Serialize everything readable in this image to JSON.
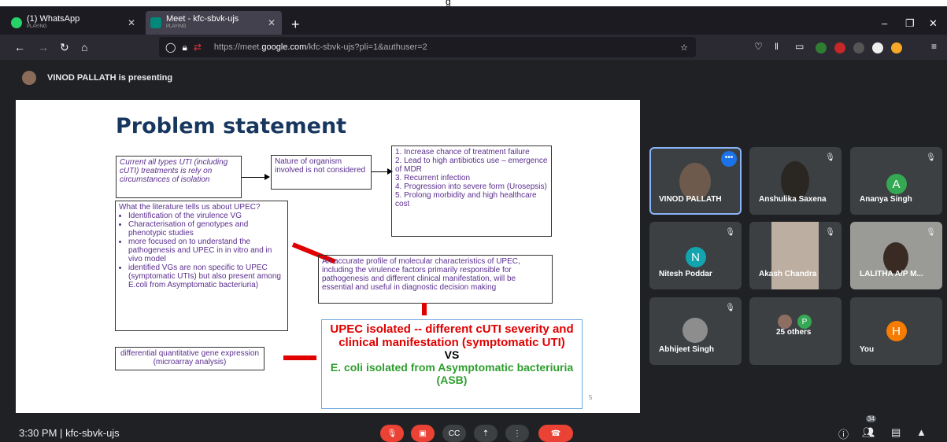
{
  "topstrip": {
    "text": "g"
  },
  "tabs": [
    {
      "title": "(1) WhatsApp",
      "sub": "PLAYING"
    },
    {
      "title": "Meet - kfc-sbvk-ujs",
      "sub": "PLAYING"
    }
  ],
  "url": {
    "prefix": "https://meet.",
    "domain": "google.com",
    "path": "/kfc-sbvk-ujs?pli=1&authuser=2"
  },
  "presenting": "VINOD PALLATH is presenting",
  "slide": {
    "title": "Problem statement",
    "box1": "Current all types UTI (including cUTI) treatments is rely on circumstances of isolation",
    "box2": "Nature of organism involved is not considered",
    "box3": [
      "1.  Increase chance of treatment failure",
      "2.  Lead to high antibiotics use – emergence of MDR",
      "3.  Recurrent infection",
      "4.  Progression into severe form (Urosepsis)",
      "5.  Prolong morbidity and high healthcare cost"
    ],
    "lit_head": "What the literature tells us about UPEC?",
    "lit_items": [
      "Identification of the virulence VG",
      "Characterisation of genotypes and phenotypic studies",
      "more focused on to understand the pathogenesis and UPEC in in vitro and in vivo model",
      "identified VGs are non specific to UPEC (symptomatic UTIs) but also present among E.coli from Asymptomatic bacteriuria)"
    ],
    "profile": "An accurate profile of molecular characteristics of UPEC, including the virulence factors primarily responsible for pathogenesis and different clinical manifestation, will be essential and useful in diagnostic decision making",
    "diff": "differential quantitative gene expression (microarray analysis)",
    "conc1": "UPEC isolated -- different cUTI severity and clinical manifestation (symptomatic UTI)",
    "conc2": "VS",
    "conc3": "E. coli isolated from Asymptomatic bacteriuria (ASB)",
    "page": "5"
  },
  "participants": [
    {
      "name": "VINOD PALLATH"
    },
    {
      "name": "Anshulika Saxena"
    },
    {
      "name": "Ananya Singh",
      "initial": "A",
      "color": "#34a853"
    },
    {
      "name": "Nitesh Poddar",
      "initial": "N",
      "color": "#12a4af"
    },
    {
      "name": "Akash Chandra"
    },
    {
      "name": "LALITHA A/P M..."
    },
    {
      "name": "Abhijeet Singh"
    },
    {
      "name": "25 others",
      "initial": "P",
      "color": "#34a853"
    },
    {
      "name": "You",
      "initial": "H",
      "color": "#f57c00"
    }
  ],
  "bottom": {
    "time": "3:30 PM",
    "sep": "|",
    "meeting": "kfc-sbvk-ujs",
    "people_count": "34"
  },
  "icons": {
    "mute": "mic-off-icon",
    "camera": "camera-off-icon",
    "cc": "captions-icon",
    "present": "present-icon",
    "more": "more-icon",
    "hangup": "hangup-icon"
  }
}
